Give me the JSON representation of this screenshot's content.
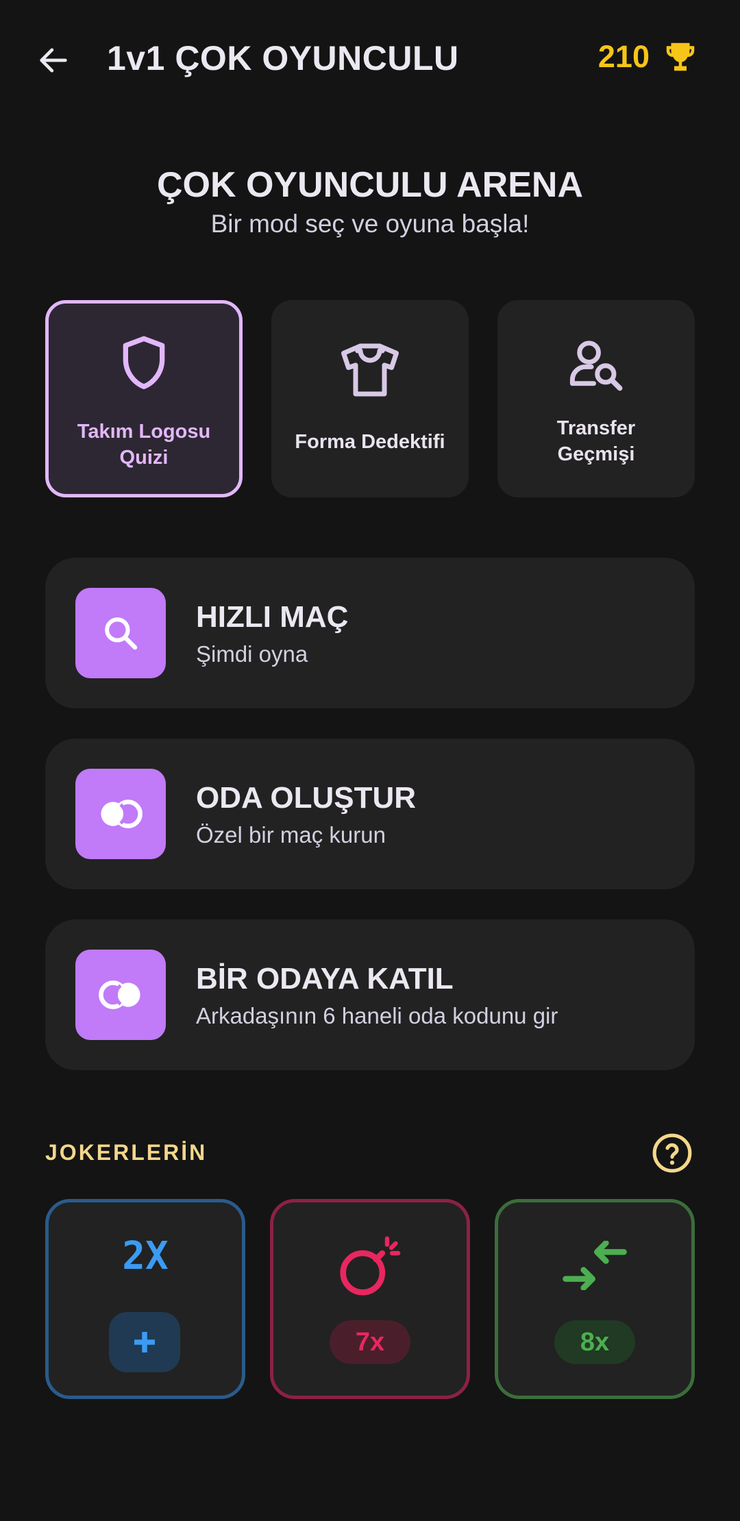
{
  "header": {
    "title": "1v1 ÇOK OYUNCULU",
    "score": "210",
    "score_color": "#f5c518"
  },
  "arena": {
    "title": "ÇOK OYUNCULU ARENA",
    "subtitle": "Bir mod seç ve oyuna başla!"
  },
  "modes": [
    {
      "label_line1": "Takım Logosu",
      "label_line2": "Quizi",
      "icon": "shield-icon",
      "selected": true
    },
    {
      "label_line1": "Forma Dedektifi",
      "label_line2": "",
      "icon": "shirt-icon",
      "selected": false
    },
    {
      "label_line1": "Transfer",
      "label_line2": "Geçmişi",
      "icon": "user-search-icon",
      "selected": false
    }
  ],
  "actions": [
    {
      "title": "HIZLI MAÇ",
      "subtitle": "Şimdi oyna",
      "icon": "search-icon"
    },
    {
      "title": "ODA OLUŞTUR",
      "subtitle": "Özel bir maç kurun",
      "icon": "rings-icon"
    },
    {
      "title": "BİR ODAYA KATIL",
      "subtitle": "Arkadaşının 6 haneli oda kodunu gir",
      "icon": "rings-icon"
    }
  ],
  "jokers": {
    "label": "JOKERLERİN",
    "items": [
      {
        "icon": "double-points-icon",
        "icon_text": "2X",
        "count": "",
        "color": "#3b9bf3"
      },
      {
        "icon": "bomb-icon",
        "count": "7x",
        "color": "#e8275f"
      },
      {
        "icon": "arrows-in-icon",
        "count": "8x",
        "color": "#4caf50"
      }
    ]
  },
  "colors": {
    "accent": "#c17af8",
    "selected_border": "#e2b7fb",
    "background": "#141414",
    "card": "#222222"
  }
}
